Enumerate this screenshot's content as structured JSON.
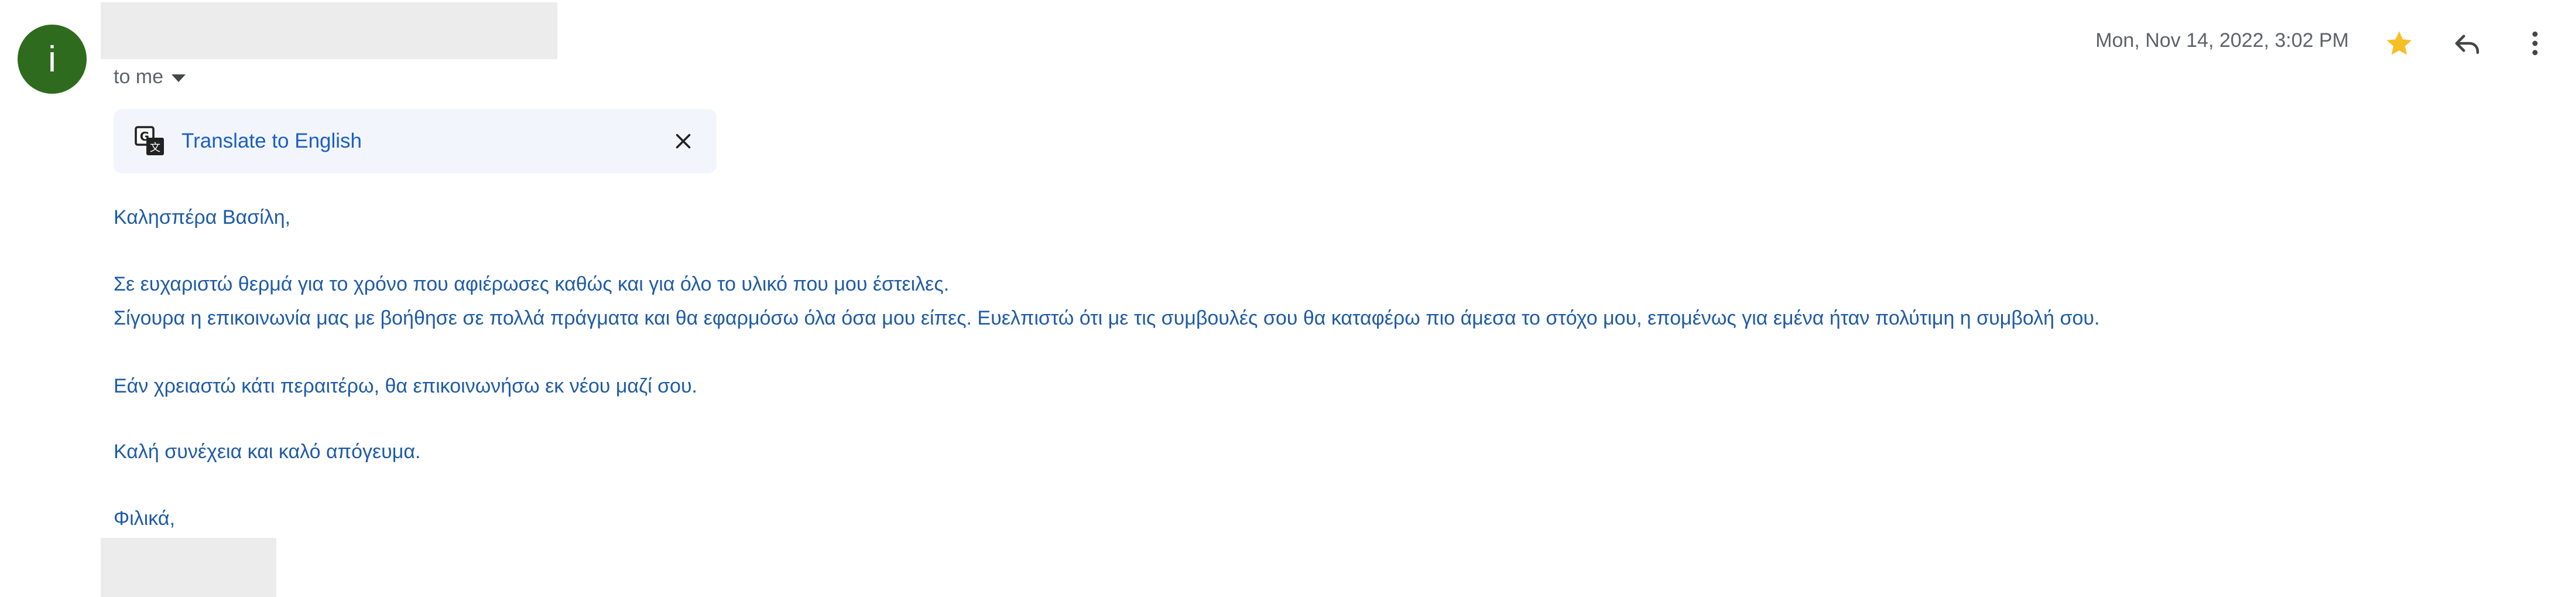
{
  "sender": {
    "avatar_letter": "i",
    "avatar_color": "#2e6b1e",
    "recipient_label": "to me"
  },
  "header": {
    "date": "Mon, Nov 14, 2022, 3:02 PM",
    "star_icon": "star-icon",
    "star_color": "#f6bf26",
    "reply_icon": "reply-icon",
    "more_icon": "more-vert-icon"
  },
  "translate": {
    "label": "Translate to English",
    "icon": "translate-icon",
    "close_icon": "close-icon"
  },
  "body": {
    "greeting": "Καλησπέρα Βασίλη,",
    "paragraph1_line1": "Σε ευχαριστώ θερμά για το χρόνο που αφιέρωσες καθώς και για όλο το υλικό που μου έστειλες.",
    "paragraph1_line2": "Σίγουρα η επικοινωνία μας με βοήθησε σε πολλά πράγματα και θα εφαρμόσω όλα όσα μου είπες. Ευελπιστώ ότι με τις συμβουλές σου θα καταφέρω πιο άμεσα το στόχο μου, επομένως για εμένα ήταν πολύτιμη η συμβολή σου.",
    "paragraph2": "Εάν χρειαστώ κάτι περαιτέρω, θα επικοινωνήσω εκ νέου μαζί σου.",
    "paragraph3": "Καλή συνέχεια και καλό απόγευμα.",
    "signoff": "Φιλικά,",
    "text_color": "#1e5ba8"
  }
}
